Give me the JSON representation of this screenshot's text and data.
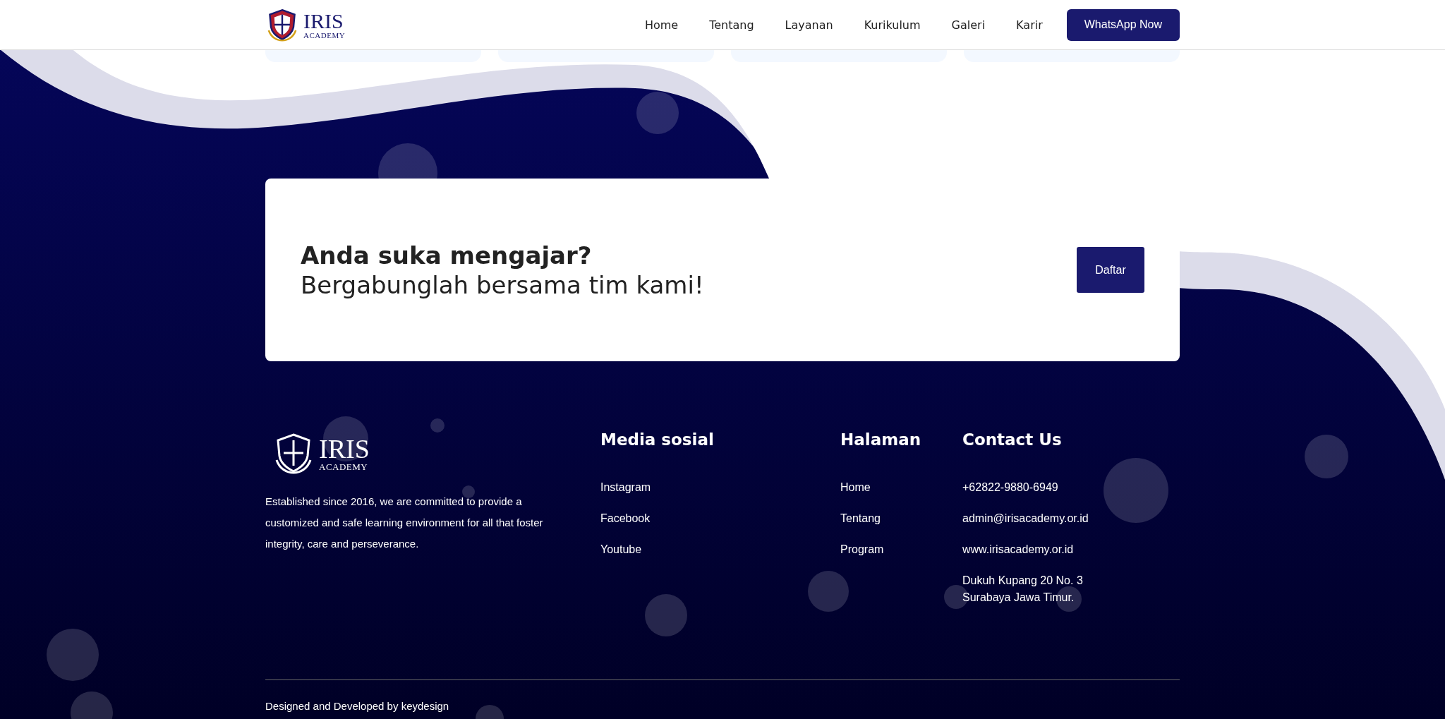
{
  "header": {
    "logo": {
      "name": "IRIS",
      "sub": "ACADEMY"
    },
    "nav": [
      "Home",
      "Tentang",
      "Layanan",
      "Kurikulum",
      "Galeri",
      "Karir"
    ],
    "cta": "WhatsApp Now"
  },
  "join_card": {
    "title": "Anda suka mengajar?",
    "subtitle": "Bergabunglah bersama tim kami!",
    "button": "Daftar"
  },
  "footer": {
    "logo": {
      "name": "IRIS",
      "sub": "ACADEMY"
    },
    "about": "Established since 2016, we are committed to provide a customized and safe learning environment for all that foster integrity, care and perseverance.",
    "columns": [
      {
        "title": "Media sosial",
        "items": [
          "Instagram",
          "Facebook",
          "Youtube"
        ]
      },
      {
        "title": "Halaman",
        "items": [
          "Home",
          "Tentang",
          "Program"
        ]
      },
      {
        "title": "Contact Us",
        "items": [
          "+62822-9880-6949",
          "admin@irisacademy.or.id",
          "www.irisacademy.or.id",
          "Dukuh Kupang 20 No. 3\nSurabaya Jawa Timur."
        ]
      }
    ],
    "credit": "Designed and Developed by keydesign"
  }
}
